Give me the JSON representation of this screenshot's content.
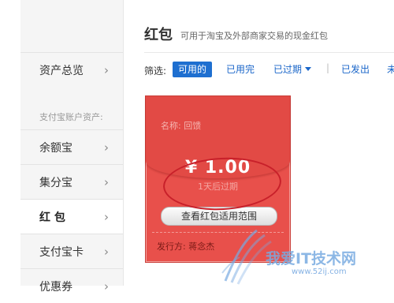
{
  "sidebar": {
    "items": [
      {
        "label": "资产总览",
        "active": false
      },
      {
        "label": "余额宝",
        "active": false
      },
      {
        "label": "集分宝",
        "active": false
      },
      {
        "label": "红 包",
        "active": true
      },
      {
        "label": "支付宝卡",
        "active": false
      },
      {
        "label": "优惠券",
        "active": false
      }
    ],
    "group_label": "支付宝账户资产:",
    "chevron": "›"
  },
  "page": {
    "title": "红包",
    "subtitle": "可用于淘宝及外部商家交易的现金红包"
  },
  "filters": {
    "label": "筛选:",
    "options": [
      "可用的",
      "已用完",
      "已过期",
      "已发出",
      "未"
    ],
    "active": "可用的",
    "separator": "|"
  },
  "packet": {
    "name": "名称: 回馈",
    "amount": "¥ 1.00",
    "expire": "1天后过期",
    "button": "查看红包适用范围",
    "issuer": "发行方: 蒋念杰"
  },
  "watermark": {
    "brand": "我爱IT技术网",
    "url": "www.52ij.com"
  },
  "colors": {
    "accent_blue": "#1e6fd0",
    "packet_red": "#e8504b",
    "annotation_red": "#c8202a"
  }
}
